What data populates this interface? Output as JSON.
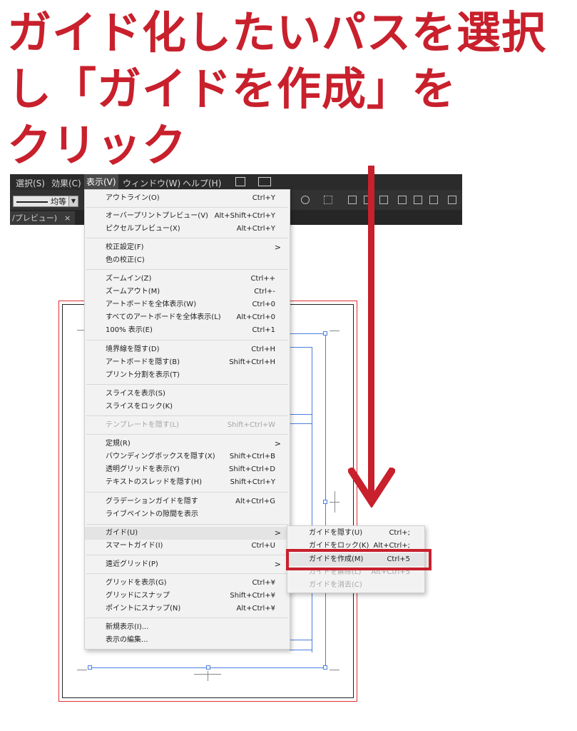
{
  "heading": {
    "line1": "ガイド化したいパスを選択",
    "line2": "し「ガイドを作成」を",
    "line3": "クリック"
  },
  "menubar": {
    "items": [
      "選択(S)",
      "効果(C)",
      "表示(V)",
      "ウィンドウ(W)",
      "ヘルプ(H)"
    ],
    "active_index": 2
  },
  "toolbar": {
    "stroke_label": "均等"
  },
  "tabbar": {
    "doc_tab": "/プレビュー)",
    "close": "×"
  },
  "view_menu": {
    "items": [
      {
        "label": "アウトライン(O)",
        "shortcut": "Ctrl+Y"
      },
      {
        "label": "オーバープリントプレビュー(V)",
        "shortcut": "Alt+Shift+Ctrl+Y"
      },
      {
        "label": "ピクセルプレビュー(X)",
        "shortcut": "Alt+Ctrl+Y"
      },
      {
        "label": "校正設定(F)",
        "shortcut": ">"
      },
      {
        "label": "色の校正(C)",
        "shortcut": ""
      },
      {
        "label": "ズームイン(Z)",
        "shortcut": "Ctrl++"
      },
      {
        "label": "ズームアウト(M)",
        "shortcut": "Ctrl+-"
      },
      {
        "label": "アートボードを全体表示(W)",
        "shortcut": "Ctrl+0"
      },
      {
        "label": "すべてのアートボードを全体表示(L)",
        "shortcut": "Alt+Ctrl+0"
      },
      {
        "label": "100% 表示(E)",
        "shortcut": "Ctrl+1"
      },
      {
        "label": "境界線を隠す(D)",
        "shortcut": "Ctrl+H"
      },
      {
        "label": "アートボードを隠す(B)",
        "shortcut": "Shift+Ctrl+H"
      },
      {
        "label": "プリント分割を表示(T)",
        "shortcut": ""
      },
      {
        "label": "スライスを表示(S)",
        "shortcut": ""
      },
      {
        "label": "スライスをロック(K)",
        "shortcut": ""
      },
      {
        "label": "テンプレートを隠す(L)",
        "shortcut": "Shift+Ctrl+W"
      },
      {
        "label": "定規(R)",
        "shortcut": ">"
      },
      {
        "label": "バウンディングボックスを隠す(X)",
        "shortcut": "Shift+Ctrl+B"
      },
      {
        "label": "透明グリッドを表示(Y)",
        "shortcut": "Shift+Ctrl+D"
      },
      {
        "label": "テキストのスレッドを隠す(H)",
        "shortcut": "Shift+Ctrl+Y"
      },
      {
        "label": "グラデーションガイドを隠す",
        "shortcut": "Alt+Ctrl+G"
      },
      {
        "label": "ライブペイントの隙間を表示",
        "shortcut": ""
      },
      {
        "label": "ガイド(U)",
        "shortcut": ">"
      },
      {
        "label": "スマートガイド(I)",
        "shortcut": "Ctrl+U"
      },
      {
        "label": "遠近グリッド(P)",
        "shortcut": ">"
      },
      {
        "label": "グリッドを表示(G)",
        "shortcut": "Ctrl+¥"
      },
      {
        "label": "グリッドにスナップ",
        "shortcut": "Shift+Ctrl+¥"
      },
      {
        "label": "ポイントにスナップ(N)",
        "shortcut": "Alt+Ctrl+¥"
      },
      {
        "label": "新規表示(I)...",
        "shortcut": ""
      },
      {
        "label": "表示の編集...",
        "shortcut": ""
      }
    ]
  },
  "guide_submenu": {
    "items": [
      {
        "label": "ガイドを隠す(U)",
        "shortcut": "Ctrl+;"
      },
      {
        "label": "ガイドをロック(K)",
        "shortcut": "Alt+Ctrl+;"
      },
      {
        "label": "ガイドを作成(M)",
        "shortcut": "Ctrl+5"
      },
      {
        "label": "ガイドを解除(L)",
        "shortcut": "Alt+Ctrl+5"
      },
      {
        "label": "ガイドを消去(C)",
        "shortcut": ""
      }
    ],
    "highlighted_index": 2
  },
  "colors": {
    "accent_red": "#c8202c",
    "guide_blue": "#4a7ee0",
    "menu_bg": "#f2f2f2",
    "chrome_dark": "#2b2b2b"
  }
}
